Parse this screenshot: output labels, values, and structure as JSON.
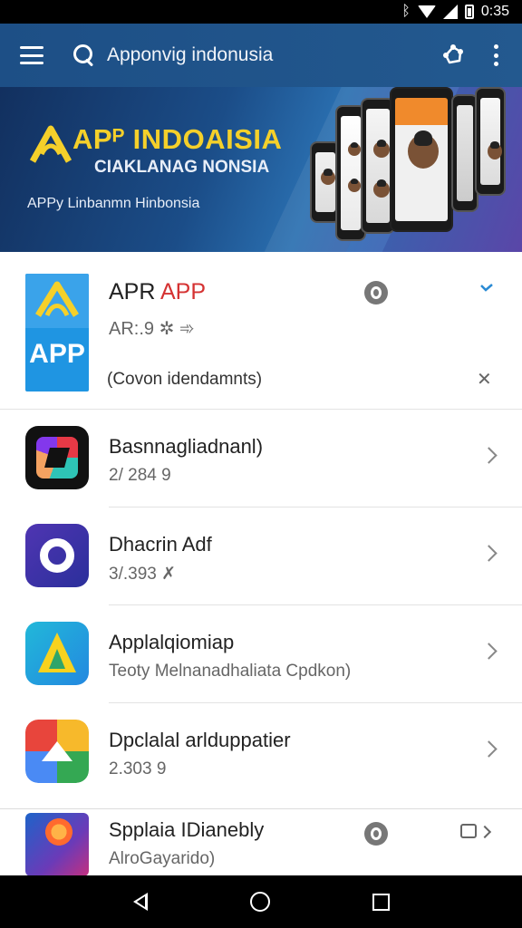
{
  "status_bar": {
    "time": "0:35",
    "bluetooth": "ᛒ"
  },
  "app_bar": {
    "search_text": "Apponvig indonusia",
    "icons": [
      "menu-icon",
      "search-icon",
      "share-icon",
      "more-vert-icon"
    ]
  },
  "banner": {
    "title": "APᴾ INDOAISIA",
    "subtitle": "CIAKLANAG NONSIA",
    "tagline": "APPy Linbanmn Hinbonsia"
  },
  "featured": {
    "name_part1": "APR ",
    "name_part2": "APP",
    "icon_text": "APP",
    "meta": "AR:.9 ✲   ➾",
    "description": "(Covon idendamnts)",
    "colors": {
      "accent_red": "#d53232",
      "icon_blue": "#1f95e2"
    }
  },
  "apps": [
    {
      "title": "Basnnagliadnanl)",
      "subtitle": "2/ 284 9"
    },
    {
      "title": "Dhacrin Adf",
      "subtitle": "3/.393 ✗"
    },
    {
      "title": "Applalqiomiap",
      "subtitle": "Teoty Melnanadhaliata Cpdkon)"
    },
    {
      "title": "Dpclalal arlduppatier",
      "subtitle": "2.303 9"
    }
  ],
  "last_app": {
    "title": "Spplaia IDianebly",
    "subtitle": "AlroGayarido)"
  },
  "nav": {
    "icons": [
      "back-icon",
      "home-icon",
      "recents-icon"
    ]
  }
}
